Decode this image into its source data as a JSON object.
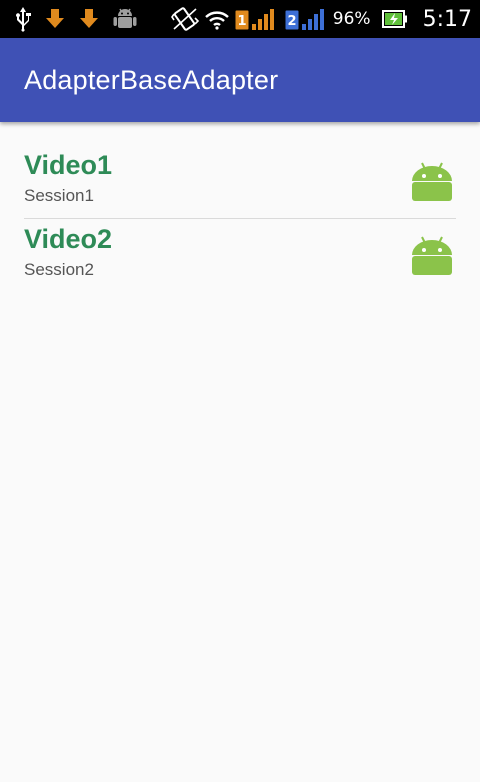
{
  "status_bar": {
    "icons": [
      "usb-icon",
      "download-icon",
      "download-icon",
      "android-debug-icon",
      "vibrate-icon",
      "wifi-icon",
      "sim1-signal-icon",
      "sim2-signal-icon",
      "battery-charging-icon"
    ],
    "sim1_label": "1",
    "sim2_label": "2",
    "battery_percent": "96%",
    "clock": "5:17"
  },
  "action_bar": {
    "title": "AdapterBaseAdapter",
    "color": "#3f51b5"
  },
  "list": {
    "items": [
      {
        "title": "Video1",
        "subtitle": "Session1",
        "icon": "android-icon"
      },
      {
        "title": "Video2",
        "subtitle": "Session2",
        "icon": "android-icon"
      }
    ]
  },
  "colors": {
    "title_green": "#2e8b57",
    "android_green": "#8bc34a",
    "download_orange": "#e08a1e"
  }
}
